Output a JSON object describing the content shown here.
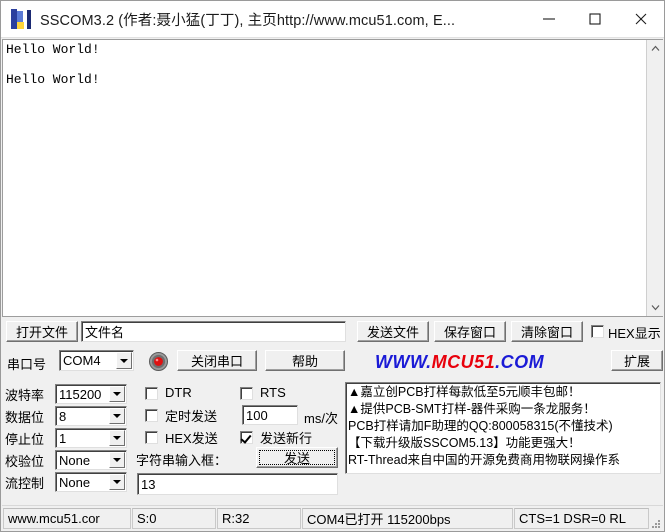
{
  "window": {
    "title": "SSCOM3.2 (作者:聂小猛(丁丁), 主页http://www.mcu51.com,  E...",
    "minimize_label": "—",
    "maximize_label": "□",
    "close_label": "✕"
  },
  "terminal": {
    "content": "Hello World!\n\nHello World!"
  },
  "file_toolbar": {
    "open_file": "打开文件",
    "filename_value": "文件名",
    "send_file": "发送文件",
    "save_window": "保存窗口",
    "clear_window": "清除窗口",
    "hex_display": "HEX显示",
    "hex_display_checked": false
  },
  "port_toolbar": {
    "port_label": "串口号",
    "port_value": "COM4",
    "close_port": "关闭串口",
    "help": "帮助",
    "expand": "扩展",
    "logo_prefix": "WWW.",
    "logo_mid": "MCU51",
    "logo_suffix": ".COM",
    "logo_blue": "#1a1ad6",
    "logo_red": "#e8000b"
  },
  "serial_settings": [
    {
      "label": "波特率",
      "value": "115200"
    },
    {
      "label": "数据位",
      "value": "8"
    },
    {
      "label": "停止位",
      "value": "1"
    },
    {
      "label": "校验位",
      "value": "None"
    },
    {
      "label": "流控制",
      "value": "None"
    }
  ],
  "send_options": {
    "dtr_label": "DTR",
    "dtr_checked": false,
    "rts_label": "RTS",
    "rts_checked": false,
    "timed_send_label": "定时发送",
    "timed_send_checked": false,
    "interval_value": "100",
    "interval_unit": "ms/次",
    "hex_send_label": "HEX发送",
    "hex_send_checked": false,
    "send_newline_label": "发送新行",
    "send_newline_checked": true,
    "string_input_label": "字符串输入框：",
    "send_button": "发送",
    "send_text_value": "13"
  },
  "ad_panel": {
    "lines": [
      "▲嘉立创PCB打样每款低至5元顺丰包邮！",
      "▲提供PCB-SMT打样-器件采购一条龙服务！",
      "PCB打样请加F助理的QQ:800058315(不懂技术)",
      "【下载升级版SSCOM5.13】功能更强大！",
      "RT-Thread来自中国的开源免费商用物联网操作系"
    ]
  },
  "status_bar": {
    "site": "www.mcu51.cor",
    "sent": "S:0",
    "received": "R:32",
    "connection": "COM4已打开  115200bps",
    "signals": "CTS=1 DSR=0 RL"
  }
}
